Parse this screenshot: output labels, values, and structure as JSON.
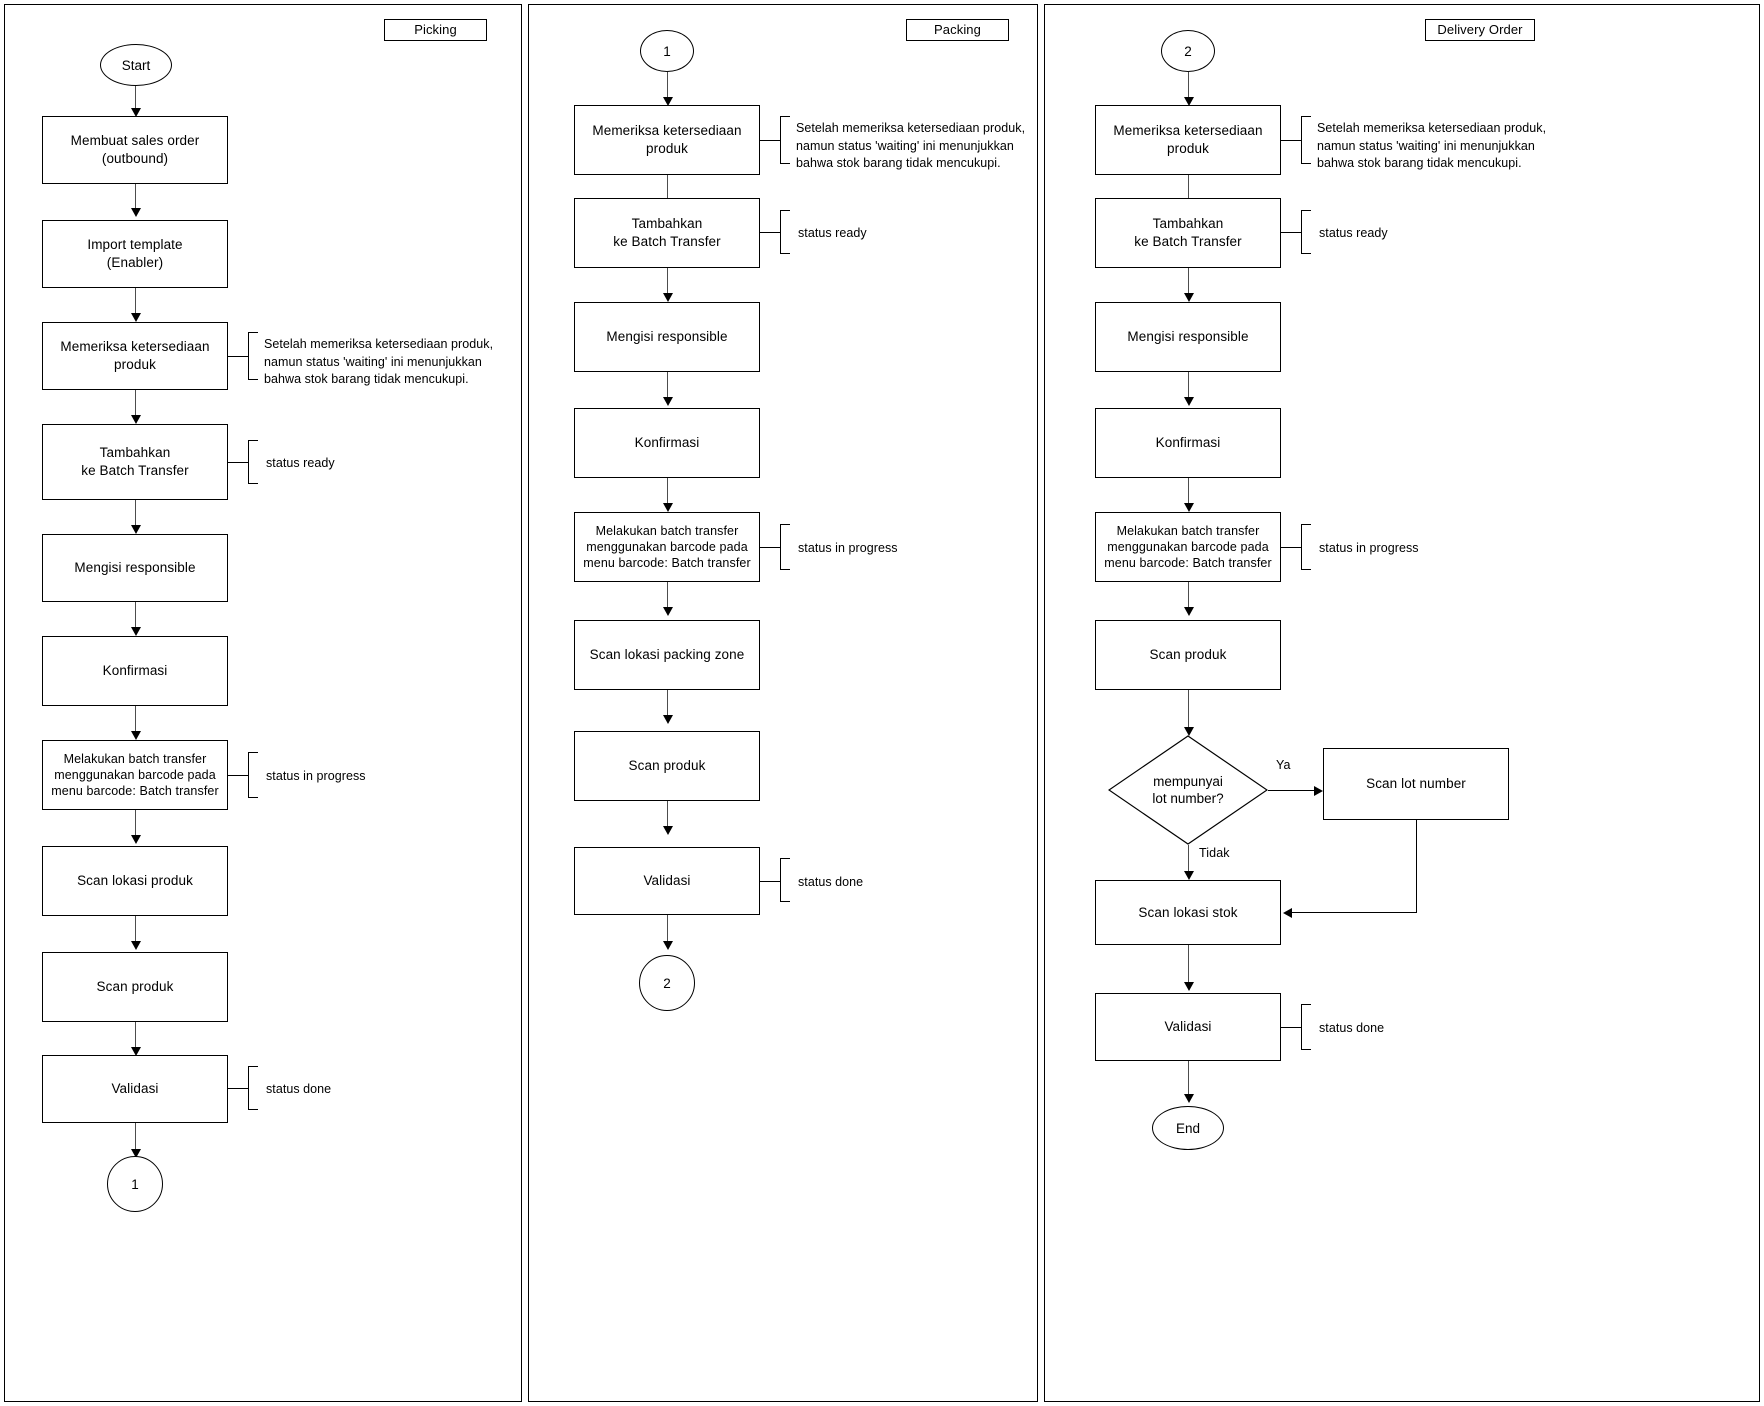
{
  "lanes": [
    {
      "id": "picking",
      "title": "Picking"
    },
    {
      "id": "packing",
      "title": "Packing"
    },
    {
      "id": "delivery",
      "title": "Delivery Order"
    }
  ],
  "notes": {
    "stock_warning": "Setelah memeriksa ketersediaan produk,\nnamun status 'waiting' ini menunjukkan\nbahwa stok barang tidak mencukupi.",
    "status_ready": "status ready",
    "status_in_progress": "status in progress",
    "status_done": "status done"
  },
  "edge_labels": {
    "yes": "Ya",
    "no": "Tidak"
  },
  "picking": {
    "start": "Start",
    "nodes": [
      "Membuat sales order\n(outbound)",
      "Import template\n(Enabler)",
      "Memeriksa ketersediaan produk",
      "Tambahkan\nke Batch Transfer",
      "Mengisi responsible",
      "Konfirmasi",
      "Melakukan batch transfer\nmenggunakan barcode pada\nmenu barcode: Batch transfer",
      "Scan lokasi produk",
      "Scan produk",
      "Validasi"
    ],
    "end_connector": "1"
  },
  "packing": {
    "start_connector": "1",
    "nodes": [
      "Memeriksa ketersediaan produk",
      "Tambahkan\nke Batch Transfer",
      "Mengisi responsible",
      "Konfirmasi",
      "Melakukan batch transfer\nmenggunakan barcode pada\nmenu barcode: Batch transfer",
      "Scan lokasi packing zone",
      "Scan produk",
      "Validasi"
    ],
    "end_connector": "2"
  },
  "delivery": {
    "start_connector": "2",
    "nodes": [
      "Memeriksa ketersediaan produk",
      "Tambahkan\nke Batch Transfer",
      "Mengisi responsible",
      "Konfirmasi",
      "Melakukan batch transfer\nmenggunakan barcode pada\nmenu barcode: Batch transfer",
      "Scan produk"
    ],
    "decision": "mempunyai\nlot number?",
    "branch_yes_node": "Scan lot number",
    "after_decision": [
      "Scan lokasi stok",
      "Validasi"
    ],
    "end": "End"
  }
}
